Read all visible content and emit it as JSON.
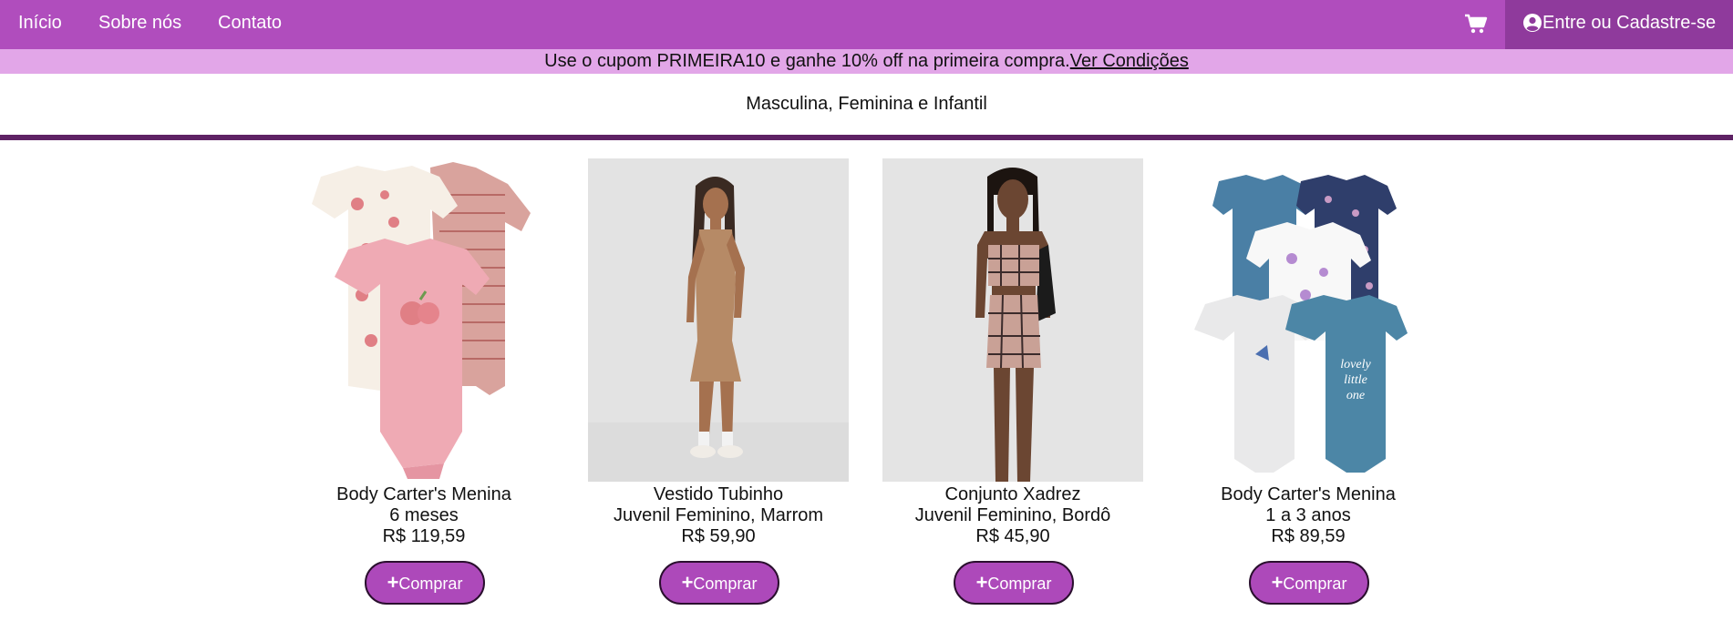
{
  "nav": {
    "links": [
      "Início",
      "Sobre nós",
      "Contato"
    ],
    "cart_icon": "shopping-cart-icon",
    "login_icon": "user-circle-icon",
    "login_label": "Entre ou Cadastre-se"
  },
  "promo": {
    "text": "Use o cupom PRIMEIRA10 e ganhe 10% off na primeira compra.",
    "link": "Ver Condições"
  },
  "categories": "Masculina, Feminina e Infantil",
  "colors": {
    "nav_bg": "#b04dbd",
    "login_bg": "#8f3a9c",
    "promo_bg": "#e2a6e8",
    "divider": "#5e2264",
    "button_bg": "#ad49ba"
  },
  "products": [
    {
      "name": "Body Carter's Menina",
      "sub": "6 meses",
      "price": "R$ 119,59",
      "button": "Comprar",
      "image": "pink bodysuits set"
    },
    {
      "name": "Vestido Tubinho",
      "sub": "Juvenil Feminino, Marrom",
      "price": "R$ 59,90",
      "button": "Comprar",
      "image": "brown knit dress model"
    },
    {
      "name": "Conjunto Xadrez",
      "sub": "Juvenil Feminino, Bordô",
      "price": "R$ 45,90",
      "button": "Comprar",
      "image": "plaid two-piece model"
    },
    {
      "name": "Body Carter's Menina",
      "sub": "1 a 3 anos",
      "price": "R$ 89,59",
      "button": "Comprar",
      "image": "blue butterfly bodysuits set"
    }
  ]
}
